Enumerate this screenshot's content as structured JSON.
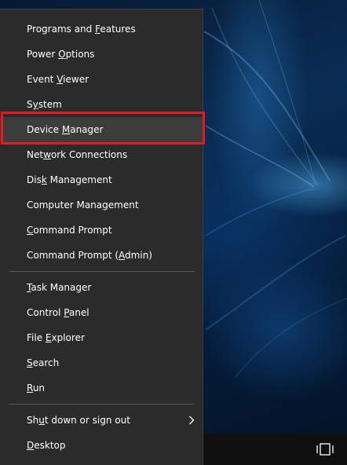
{
  "menu": {
    "items": [
      {
        "pre": "Programs and ",
        "acc": "F",
        "post": "eatures"
      },
      {
        "pre": "Power ",
        "acc": "O",
        "post": "ptions"
      },
      {
        "pre": "Event ",
        "acc": "V",
        "post": "iewer"
      },
      {
        "pre": "S",
        "acc": "y",
        "post": "stem"
      },
      {
        "pre": "Device ",
        "acc": "M",
        "post": "anager"
      },
      {
        "pre": "Net",
        "acc": "w",
        "post": "ork Connections"
      },
      {
        "pre": "Dis",
        "acc": "k",
        "post": " Management"
      },
      {
        "pre": "Computer Mana",
        "acc": "g",
        "post": "ement"
      },
      {
        "pre": "",
        "acc": "C",
        "post": "ommand Prompt"
      },
      {
        "pre": "Command Prompt (",
        "acc": "A",
        "post": "dmin)"
      },
      {
        "pre": "",
        "acc": "T",
        "post": "ask Manager"
      },
      {
        "pre": "Control ",
        "acc": "P",
        "post": "anel"
      },
      {
        "pre": "File ",
        "acc": "E",
        "post": "xplorer"
      },
      {
        "pre": "",
        "acc": "S",
        "post": "earch"
      },
      {
        "pre": "",
        "acc": "R",
        "post": "un"
      },
      {
        "pre": "Sh",
        "acc": "u",
        "post": "t down or sign out"
      },
      {
        "pre": "",
        "acc": "D",
        "post": "esktop"
      }
    ],
    "highlighted_item": "Device Manager",
    "highlight_color": "#e21b22"
  },
  "icons": {
    "submenu_arrow": "chevron-right-icon",
    "taskbar_button": "task-view-icon"
  },
  "colors": {
    "menu_background": "#2b2b2b",
    "menu_text": "#ffffff",
    "taskbar": "#101010"
  }
}
